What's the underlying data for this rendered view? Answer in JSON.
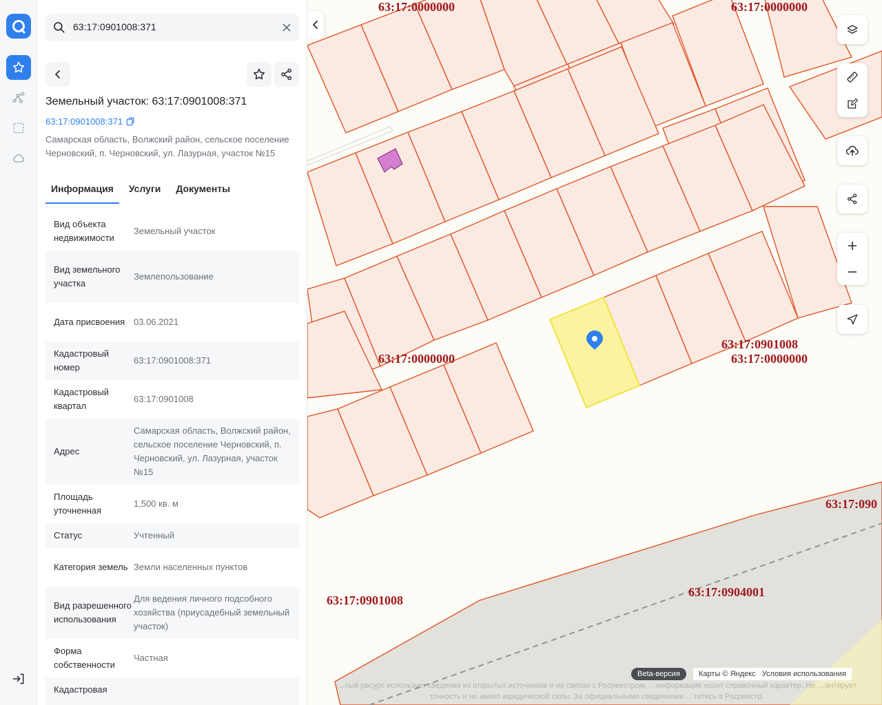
{
  "app": {
    "brand_color": "#2f80ed"
  },
  "rail": {
    "items": [
      "logo-icon",
      "star-icon",
      "route-icon",
      "selection-icon",
      "cloud-icon",
      "logout-icon"
    ]
  },
  "search": {
    "value": "63:17:0901008:371"
  },
  "parcel": {
    "title": "Земельный участок: 63:17:0901008:371",
    "cad_number": "63:17:0901008:371",
    "address": "Самарская область, Волжский район, сельское поселение Черновский, п. Черновский, ул. Лазурная, участок №15"
  },
  "tabs": [
    {
      "label": "Информация",
      "active": true
    },
    {
      "label": "Услуги",
      "active": false
    },
    {
      "label": "Документы",
      "active": false
    }
  ],
  "info": [
    {
      "key": "Вид объекта недвижимости",
      "value": "Земельный участок"
    },
    {
      "key": "Вид земельного участка",
      "value": "Землепользование"
    },
    {
      "key": "Дата присвоения",
      "value": "03.06.2021"
    },
    {
      "key": "Кадастровый номер",
      "value": "63:17:0901008:371"
    },
    {
      "key": "Кадастровый квартал",
      "value": "63:17:0901008"
    },
    {
      "key": "Адрес",
      "value": "Самарская область, Волжский район, сельское поселение Черновский, п. Черновский, ул. Лазурная, участок №15"
    },
    {
      "key": "Площадь уточненная",
      "value": "1,500 кв. м"
    },
    {
      "key": "Статус",
      "value": "Учтенный"
    },
    {
      "key": "Категория земель",
      "value": "Земли населенных пунктов"
    },
    {
      "key": "Вид разрешенного использования",
      "value": "Для ведения личного подсобного хозяйства (приусадебный земельный участок)"
    },
    {
      "key": "Форма собственности",
      "value": "Частная"
    },
    {
      "key": "Кадастровая",
      "value": ""
    }
  ],
  "map": {
    "labels": [
      "63:17:0000000",
      "63:17:0000000",
      "63:17:0901008",
      "63:17:0000000",
      "63:17:0000000",
      "63:17:090",
      "63:17:0904001",
      "63:17:0901008"
    ],
    "footer": {
      "beta": "Beta-версия",
      "copyright": "Карты © Яндекс",
      "terms": "Условия использования",
      "disclaimer": "…ный ресурс использует сведения из открытых источников и не связан с Росреестром. …информация носит справочный характер. Не …антирует точность и не имеет юридической силы. За официальными сведениями …титесь в Росреестр."
    },
    "colors": {
      "parcel_fill": "#fbeae2",
      "parcel_stroke": "#e0562a",
      "selected_fill": "#fbf3a0",
      "selected_stroke": "#f2e23e",
      "label": "#a0191e",
      "building": "#d57fd0"
    }
  }
}
